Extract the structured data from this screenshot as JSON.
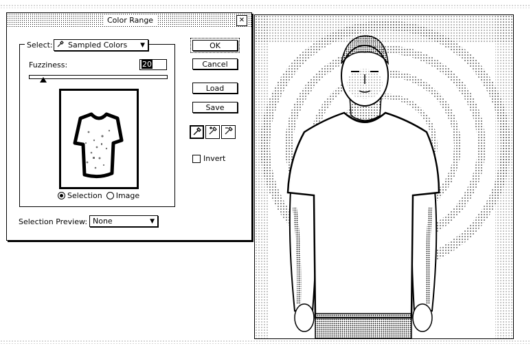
{
  "dialog": {
    "title": "Color Range",
    "close_glyph": "✕"
  },
  "select": {
    "label": "Select:",
    "value": "Sampled Colors",
    "arrow": "▼"
  },
  "fuzziness": {
    "label": "Fuzziness:",
    "value": "20",
    "level": 0.1
  },
  "preview_mode": {
    "options": [
      "Selection",
      "Image"
    ],
    "selected": "Selection"
  },
  "selection_preview": {
    "label": "Selection Preview:",
    "value": "None",
    "arrow": "▼"
  },
  "buttons": {
    "ok": "OK",
    "cancel": "Cancel",
    "load": "Load",
    "save": "Save"
  },
  "tools": [
    "eyedropper-icon",
    "eyedropper-plus-icon",
    "eyedropper-minus-icon"
  ],
  "tool_glyphs": {
    "eyedropper": "⁄",
    "plus": "+",
    "minus": "−"
  },
  "invert": {
    "label": "Invert",
    "checked": false
  }
}
